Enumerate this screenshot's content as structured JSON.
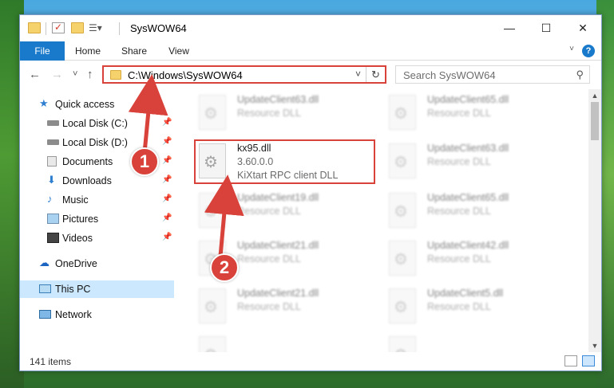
{
  "window": {
    "title": "SysWOW64",
    "controls": {
      "minimize": "—",
      "maximize": "☐",
      "close": "✕"
    }
  },
  "ribbon": {
    "tabs": [
      "File",
      "Home",
      "Share",
      "View"
    ],
    "help_icon": "?"
  },
  "address_bar": {
    "path": "C:\\Windows\\SysWOW64",
    "icons": {
      "back": "back-arrow-icon",
      "forward": "forward-arrow-icon",
      "recent": "chevron-down-icon",
      "up": "up-arrow-icon",
      "refresh": "refresh-icon"
    }
  },
  "search": {
    "placeholder": "Search SysWOW64"
  },
  "navigation": [
    {
      "label": "Quick access",
      "icon": "star-icon",
      "pinned": false
    },
    {
      "label": "Local Disk (C:)",
      "icon": "drive-icon",
      "pinned": true
    },
    {
      "label": "Local Disk (D:)",
      "icon": "drive-icon",
      "pinned": true
    },
    {
      "label": "Documents",
      "icon": "documents-icon",
      "pinned": true
    },
    {
      "label": "Downloads",
      "icon": "download-icon",
      "pinned": true
    },
    {
      "label": "Music",
      "icon": "music-icon",
      "pinned": true
    },
    {
      "label": "Pictures",
      "icon": "pictures-icon",
      "pinned": true
    },
    {
      "label": "Videos",
      "icon": "video-icon",
      "pinned": true
    },
    {
      "label": "OneDrive",
      "icon": "cloud-icon",
      "pinned": false
    },
    {
      "label": "This PC",
      "icon": "computer-icon",
      "pinned": false,
      "selected": true
    },
    {
      "label": "Network",
      "icon": "network-icon",
      "pinned": false
    }
  ],
  "files": {
    "left_column": [
      {
        "name": "UpdateClient63.dll",
        "line2": "Resource DLL",
        "line3": "",
        "faded": true
      },
      {
        "name": "kx95.dll",
        "line2": "3.60.0.0",
        "line3": "KiXtart RPC client DLL",
        "faded": false,
        "highlighted": true
      },
      {
        "name": "UpdateClient19.dll",
        "line2": "Resource DLL",
        "line3": "",
        "faded": true
      },
      {
        "name": "UpdateClient21.dll",
        "line2": "Resource DLL",
        "line3": "",
        "faded": true
      },
      {
        "name": "UpdateClient21.dll",
        "line2": "Resource DLL",
        "line3": "",
        "faded": true
      },
      {
        "name": "",
        "line2": "",
        "line3": "",
        "faded": true
      }
    ],
    "right_column": [
      {
        "name": "UpdateClient65.dll",
        "line2": "Resource DLL",
        "faded": true
      },
      {
        "name": "UpdateClient63.dll",
        "line2": "Resource DLL",
        "faded": true
      },
      {
        "name": "UpdateClient65.dll",
        "line2": "Resource DLL",
        "faded": true
      },
      {
        "name": "UpdateClient42.dll",
        "line2": "Resource DLL",
        "faded": true
      },
      {
        "name": "UpdateClient5.dll",
        "line2": "Resource DLL",
        "faded": true
      },
      {
        "name": "",
        "line2": "",
        "faded": true
      }
    ]
  },
  "status": {
    "item_count": "141 items"
  },
  "annotations": {
    "step1": "1",
    "step2": "2",
    "color": "#d9423a"
  }
}
